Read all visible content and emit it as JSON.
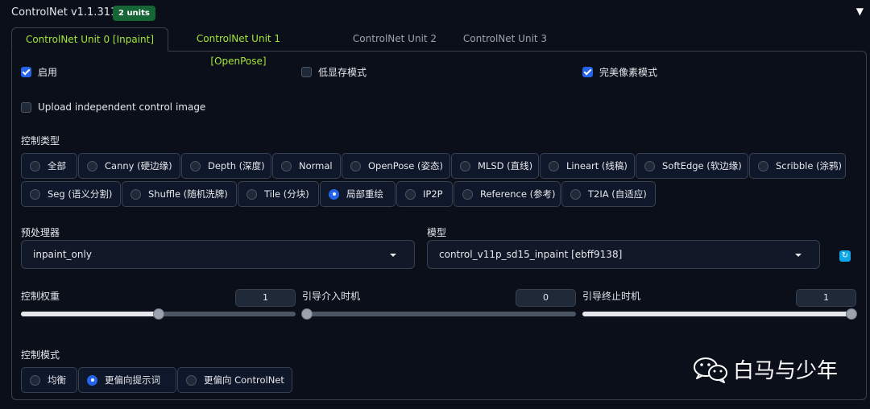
{
  "header": {
    "title": "ControlNet v1.1.311",
    "badge": "2 units",
    "collapse_icon": "▼"
  },
  "tabs": [
    {
      "label": "ControlNet Unit 0 [Inpaint]",
      "active": true
    },
    {
      "label": "ControlNet Unit 1 [OpenPose]",
      "active": false
    },
    {
      "label": "ControlNet Unit 2",
      "active": false
    },
    {
      "label": "ControlNet Unit 3",
      "active": false
    }
  ],
  "checkboxes": {
    "enable": {
      "label": "启用",
      "checked": true
    },
    "low_vram": {
      "label": "低显存模式",
      "checked": false
    },
    "pixel_perfect": {
      "label": "完美像素模式",
      "checked": true
    },
    "upload_independent": {
      "label": "Upload independent control image",
      "checked": false
    }
  },
  "control_type": {
    "label": "控制类型",
    "options": [
      "全部",
      "Canny (硬边缘)",
      "Depth (深度)",
      "Normal",
      "OpenPose (姿态)",
      "MLSD (直线)",
      "Lineart (线稿)",
      "SoftEdge (软边缘)",
      "Scribble (涂鸦)",
      "Seg (语义分割)",
      "Shuffle (随机洗牌)",
      "Tile (分块)",
      "局部重绘",
      "IP2P",
      "Reference (参考)",
      "T2IA (自适应)"
    ],
    "selected": "局部重绘"
  },
  "preprocessor": {
    "label": "预处理器",
    "value": "inpaint_only"
  },
  "model": {
    "label": "模型",
    "value": "control_v11p_sd15_inpaint [ebff9138]",
    "refresh_icon": "refresh-icon"
  },
  "sliders": {
    "weight": {
      "label": "控制权重",
      "value": "1",
      "fraction": 0.5
    },
    "start": {
      "label": "引导介入时机",
      "value": "0",
      "fraction": 0.0
    },
    "end": {
      "label": "引导终止时机",
      "value": "1",
      "fraction": 1.0
    }
  },
  "control_mode": {
    "label": "控制模式",
    "options": [
      "均衡",
      "更偏向提示词",
      "更偏向 ControlNet"
    ],
    "selected": "更偏向提示词"
  },
  "watermark": {
    "text": "白马与少年",
    "icon": "wechat-icon"
  },
  "colors": {
    "accent": "#2563eb",
    "badge": "#166534",
    "active_tab_text": "#a3e635",
    "background": "#0b0f19"
  }
}
